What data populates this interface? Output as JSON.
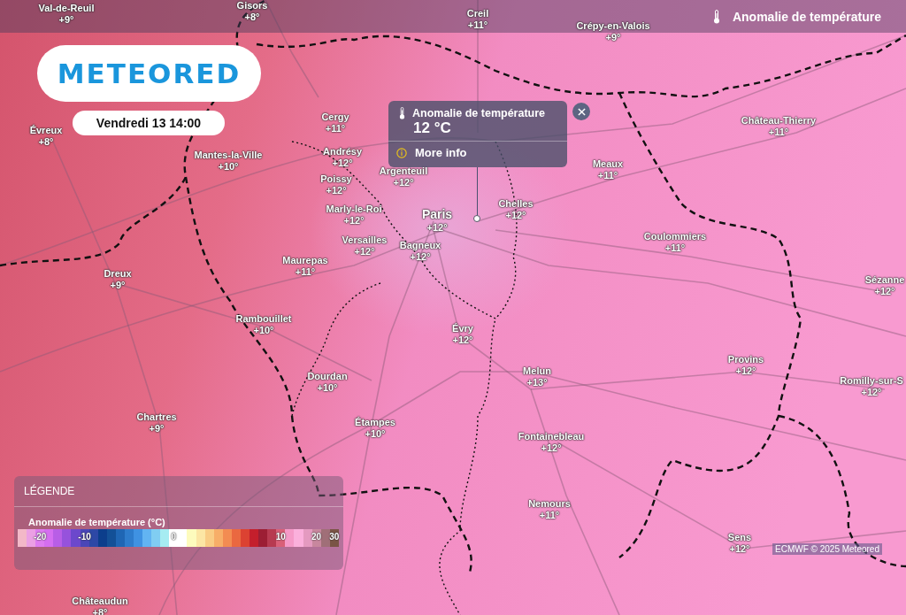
{
  "header": {
    "title": "Anomalie de température"
  },
  "logo": {
    "text": "METEORED"
  },
  "date": "Vendredi 13 14:00",
  "popup": {
    "title": "Anomalie de température",
    "value": "12 °C",
    "link": "More info"
  },
  "cities": [
    {
      "name": "Val-de-Reuil",
      "temp": "+9°"
    },
    {
      "name": "Gisors",
      "temp": "+8°"
    },
    {
      "name": "Creil",
      "temp": "+11°"
    },
    {
      "name": "Crépy-en-Valois",
      "temp": "+9°"
    },
    {
      "name": "Évreux",
      "temp": "+8°"
    },
    {
      "name": "Cergy",
      "temp": "+11°"
    },
    {
      "name": "Mantes-la-Ville",
      "temp": "+10°"
    },
    {
      "name": "Andrésy",
      "temp": "+12°"
    },
    {
      "name": "Argenteuil",
      "temp": "+12°"
    },
    {
      "name": "Poissy",
      "temp": "+12°"
    },
    {
      "name": "Meaux",
      "temp": "+11°"
    },
    {
      "name": "Château-Thierry",
      "temp": "+11°"
    },
    {
      "name": "Marly-le-Roi",
      "temp": "+12°"
    },
    {
      "name": "Paris",
      "temp": "+12°"
    },
    {
      "name": "Chelles",
      "temp": "+12°"
    },
    {
      "name": "Versailles",
      "temp": "+12°"
    },
    {
      "name": "Bagneux",
      "temp": "+12°"
    },
    {
      "name": "Coulommiers",
      "temp": "+11°"
    },
    {
      "name": "Maurepas",
      "temp": "+11°"
    },
    {
      "name": "Dreux",
      "temp": "+9°"
    },
    {
      "name": "Sézanne",
      "temp": "+12°"
    },
    {
      "name": "Rambouillet",
      "temp": "+10°"
    },
    {
      "name": "Évry",
      "temp": "+12°"
    },
    {
      "name": "Provins",
      "temp": "+12°"
    },
    {
      "name": "Melun",
      "temp": "+13°"
    },
    {
      "name": "Dourdan",
      "temp": "+10°"
    },
    {
      "name": "Romilly-sur-S",
      "temp": "+12°"
    },
    {
      "name": "Chartres",
      "temp": "+9°"
    },
    {
      "name": "Étampes",
      "temp": "+10°"
    },
    {
      "name": "Fontainebleau",
      "temp": "+12°"
    },
    {
      "name": "Nemours",
      "temp": "+11°"
    },
    {
      "name": "Sens",
      "temp": "+12°"
    },
    {
      "name": "Châteaudun",
      "temp": "+8°"
    }
  ],
  "legend": {
    "title": "LÉGENDE",
    "scale_title": "Anomalie de température (°C)",
    "stops": [
      {
        "color": "#f3b8c8"
      },
      {
        "color": "#eba0e4"
      },
      {
        "color": "#de7cf0",
        "label": "-20"
      },
      {
        "color": "#d56ef0"
      },
      {
        "color": "#b85ee6"
      },
      {
        "color": "#9652dc"
      },
      {
        "color": "#6c48cc"
      },
      {
        "color": "#4a46b8",
        "label": "-10"
      },
      {
        "color": "#2d48a6"
      },
      {
        "color": "#0c3e8c"
      },
      {
        "color": "#135097"
      },
      {
        "color": "#1f66b4"
      },
      {
        "color": "#2e7ccc"
      },
      {
        "color": "#3f92e2"
      },
      {
        "color": "#62b4f2"
      },
      {
        "color": "#80cdf2"
      },
      {
        "color": "#a6ecf2"
      },
      {
        "color": "#ffffff",
        "label": "0"
      },
      {
        "color": "#ffffff"
      },
      {
        "color": "#fdfbbd"
      },
      {
        "color": "#fce6a4"
      },
      {
        "color": "#f9cc84"
      },
      {
        "color": "#f7ae68"
      },
      {
        "color": "#f38c52"
      },
      {
        "color": "#ea6840"
      },
      {
        "color": "#dc4232"
      },
      {
        "color": "#c41f2c"
      },
      {
        "color": "#9c1e34"
      },
      {
        "color": "#b73a50"
      },
      {
        "color": "#d96078",
        "label": "10"
      },
      {
        "color": "#f59ac8"
      },
      {
        "color": "#fbb0dc"
      },
      {
        "color": "#e49ac0"
      },
      {
        "color": "#c8879e",
        "label": "20"
      },
      {
        "color": "#a06f78"
      },
      {
        "color": "#7a5445",
        "label": "30"
      }
    ]
  },
  "attribution": "ECMWF © 2025 Meteored"
}
